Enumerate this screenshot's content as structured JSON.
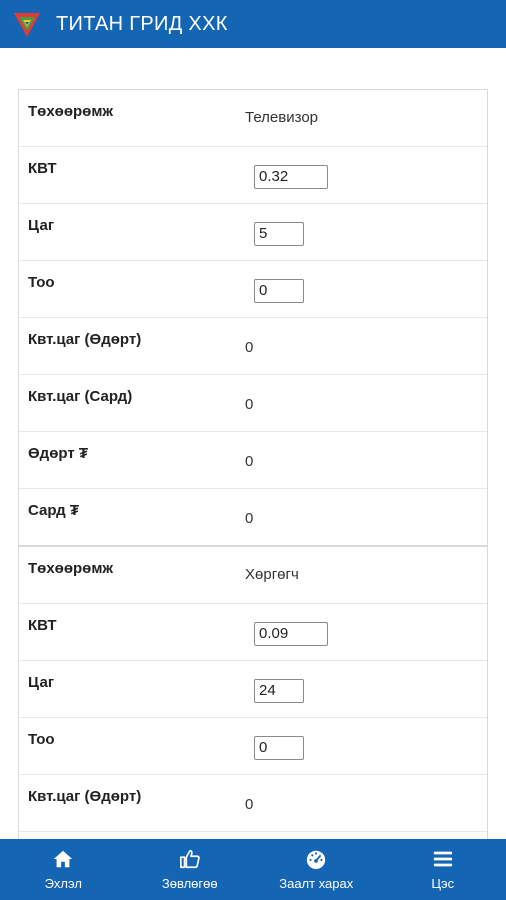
{
  "header": {
    "title": "ТИТАН ГРИД ХХК"
  },
  "cards": [
    {
      "rows": [
        {
          "label": "Төхөөрөмж",
          "value": "Телевизор"
        },
        {
          "label": "КВТ",
          "input": "0.32"
        },
        {
          "label": "Цаг",
          "input": "5"
        },
        {
          "label": "Тоо",
          "input": "0"
        },
        {
          "label": "Квт.цаг (Өдөрт)",
          "value": "0"
        },
        {
          "label": "Квт.цаг (Сард)",
          "value": "0"
        },
        {
          "label": "Өдөрт ₮",
          "value": "0"
        },
        {
          "label": "Сард ₮",
          "value": "0"
        }
      ]
    },
    {
      "rows": [
        {
          "label": "Төхөөрөмж",
          "value": "Хөргөгч"
        },
        {
          "label": "КВТ",
          "input": "0.09"
        },
        {
          "label": "Цаг",
          "input": "24"
        },
        {
          "label": "Тоо",
          "input": "0"
        },
        {
          "label": "Квт.цаг (Өдөрт)",
          "value": "0"
        }
      ]
    }
  ],
  "bottom_nav": [
    {
      "label": "Эхлэл",
      "icon": "home-icon"
    },
    {
      "label": "Зөвлөгөө",
      "icon": "thumbs-up-icon"
    },
    {
      "label": "Заалт харах",
      "icon": "gauge-icon"
    },
    {
      "label": "Цэс",
      "icon": "menu-icon"
    }
  ],
  "colors": {
    "primary": "#1565b5",
    "logo_red": "#e53935",
    "logo_green": "#43a047",
    "logo_yellow": "#fbc02d"
  }
}
